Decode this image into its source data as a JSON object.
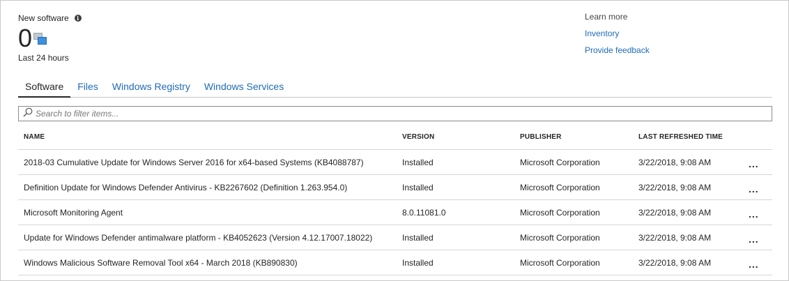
{
  "summary": {
    "label": "New software",
    "info_icon": "i",
    "count": "0",
    "period": "Last 24 hours"
  },
  "links": {
    "learn_more": "Learn more",
    "inventory": "Inventory",
    "feedback": "Provide feedback"
  },
  "tabs": [
    {
      "label": "Software",
      "active": true
    },
    {
      "label": "Files"
    },
    {
      "label": "Windows Registry"
    },
    {
      "label": "Windows Services"
    }
  ],
  "search": {
    "placeholder": "Search to filter items..."
  },
  "table": {
    "headers": {
      "name": "NAME",
      "version": "VERSION",
      "publisher": "PUBLISHER",
      "refreshed": "LAST REFRESHED TIME"
    },
    "more_label": "...",
    "rows": [
      {
        "name": "2018-03 Cumulative Update for Windows Server 2016 for x64-based Systems (KB4088787)",
        "version": "Installed",
        "publisher": "Microsoft Corporation",
        "refreshed": "3/22/2018, 9:08 AM"
      },
      {
        "name": "Definition Update for Windows Defender Antivirus - KB2267602 (Definition 1.263.954.0)",
        "version": "Installed",
        "publisher": "Microsoft Corporation",
        "refreshed": "3/22/2018, 9:08 AM"
      },
      {
        "name": "Microsoft Monitoring Agent",
        "version": "8.0.11081.0",
        "publisher": "Microsoft Corporation",
        "refreshed": "3/22/2018, 9:08 AM"
      },
      {
        "name": "Update for Windows Defender antimalware platform - KB4052623 (Version 4.12.17007.18022)",
        "version": "Installed",
        "publisher": "Microsoft Corporation",
        "refreshed": "3/22/2018, 9:08 AM"
      },
      {
        "name": "Windows Malicious Software Removal Tool x64 - March 2018 (KB890830)",
        "version": "Installed",
        "publisher": "Microsoft Corporation",
        "refreshed": "3/22/2018, 9:08 AM"
      }
    ]
  },
  "colors": {
    "link": "#1e6bb8",
    "text": "#252525",
    "border": "#c8c8c8"
  }
}
